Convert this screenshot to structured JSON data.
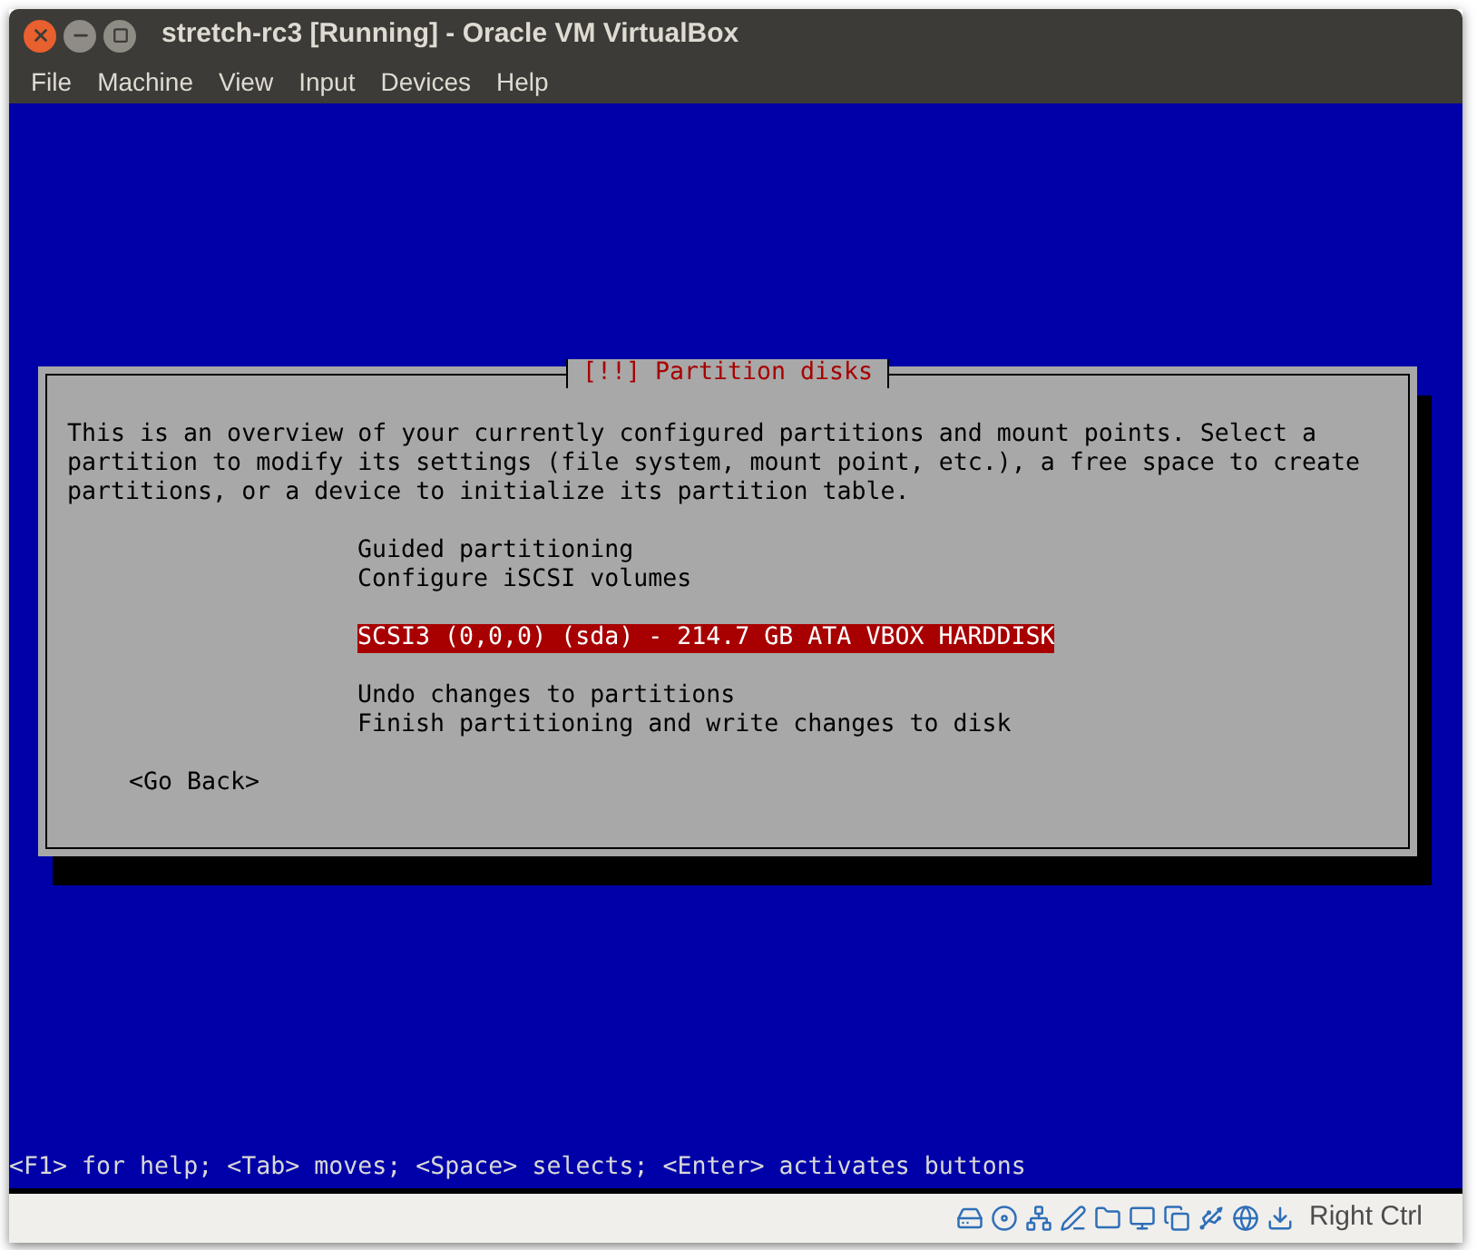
{
  "window": {
    "title": "stretch-rc3 [Running] - Oracle VM VirtualBox"
  },
  "menu": [
    "File",
    "Machine",
    "View",
    "Input",
    "Devices",
    "Help"
  ],
  "dialog": {
    "title": "[!!] Partition disks",
    "message_lines": [
      "This is an overview of your currently configured partitions and mount points. Select a",
      "partition to modify its settings (file system, mount point, etc.), a free space to create",
      "partitions, or a device to initialize its partition table."
    ],
    "groups": [
      {
        "items": [
          {
            "label": "Guided partitioning",
            "selected": false
          },
          {
            "label": "Configure iSCSI volumes",
            "selected": false
          }
        ]
      },
      {
        "items": [
          {
            "label": "SCSI3 (0,0,0) (sda) - 214.7 GB ATA VBOX HARDDISK",
            "selected": true
          }
        ]
      },
      {
        "items": [
          {
            "label": "Undo changes to partitions",
            "selected": false
          },
          {
            "label": "Finish partitioning and write changes to disk",
            "selected": false
          }
        ]
      }
    ],
    "back_button": "<Go Back>"
  },
  "help_line": "<F1> for help; <Tab> moves; <Space> selects; <Enter> activates buttons",
  "status_bar": {
    "host_key": "Right Ctrl"
  }
}
